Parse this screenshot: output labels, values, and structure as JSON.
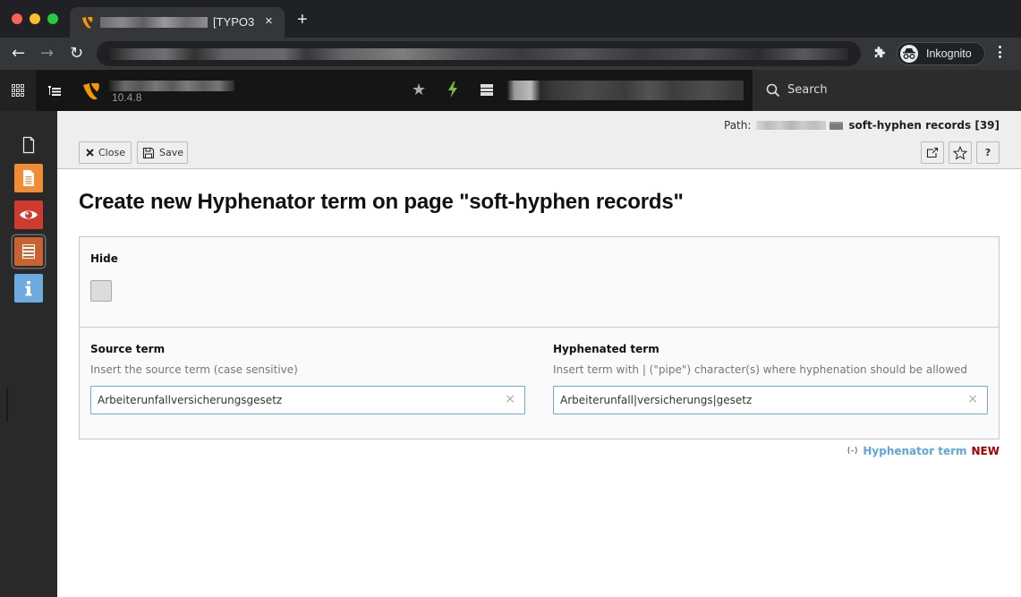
{
  "browser": {
    "tab": {
      "title_visible": "[TYPO3 ",
      "favicon": "typo3-logo-icon",
      "close_label": "×"
    },
    "new_tab_label": "+",
    "nav": {
      "back_icon": "←",
      "forward_icon": "→",
      "reload_icon": "↻"
    },
    "profile_label": "Inkognito"
  },
  "typo3": {
    "version": "10.4.8",
    "toolbar_icons": [
      "bookmark-star-icon",
      "flush-cache-bolt-icon",
      "system-info-icon"
    ],
    "search_label": "Search",
    "modules": [
      {
        "name": "page",
        "icon": "document-icon",
        "color": null
      },
      {
        "name": "layout",
        "icon": "page-layout-icon",
        "color": "#f08c34"
      },
      {
        "name": "view",
        "icon": "eye-icon",
        "color": "#d03b30"
      },
      {
        "name": "list",
        "icon": "list-icon",
        "color": "#c96131",
        "active": true
      },
      {
        "name": "info",
        "icon": "info-icon",
        "color": "#6daae0"
      }
    ]
  },
  "docheader": {
    "path_label": "Path:",
    "path_page": "soft-hyphen records [39]",
    "buttons": {
      "close": "Close",
      "save": "Save",
      "help": "?"
    }
  },
  "form": {
    "title": "Create new Hyphenator term on page \"soft-hyphen records\"",
    "hide": {
      "label": "Hide",
      "checked": false
    },
    "source_term": {
      "label": "Source term",
      "description": "Insert the source term (case sensitive)",
      "value": "Arbeiterunfallversicherungsgesetz",
      "clear_label": "×"
    },
    "hyphenated_term": {
      "label": "Hyphenated term",
      "description": "Insert term with | (\"pipe\") character(s) where hyphenation should be allowed",
      "value": "Arbeiterunfall|versicherungs|gesetz",
      "clear_label": "×"
    },
    "record_info": {
      "icon": "(–)",
      "type": "Hyphenator term",
      "status": "NEW"
    }
  },
  "colors": {
    "typo3_orange": "#f49700",
    "link_blue": "#5ea6db",
    "new_red": "#a00000",
    "input_focus_border": "#6daae0"
  }
}
